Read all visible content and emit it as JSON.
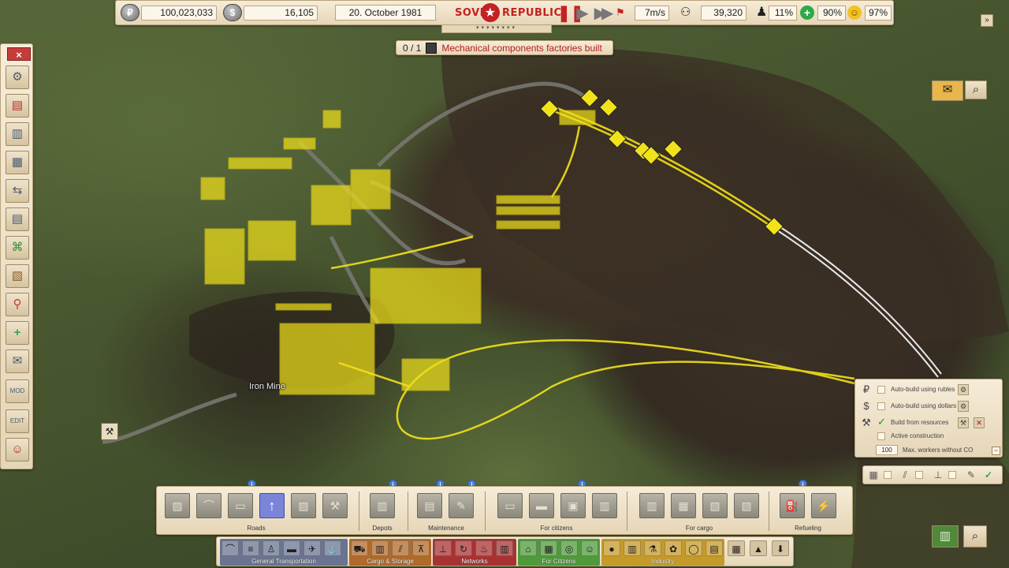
{
  "topbar": {
    "rubles_icon": "₽",
    "rubles": "100,023,033",
    "dollars_icon": "$",
    "dollars": "16,105",
    "date": "20. October 1981",
    "logo_left": "SOVIE",
    "logo_right": "REPUBLIC",
    "pause_icon": "pause-icon",
    "play_icon": "play-icon",
    "fast_icon": "fast-forward-icon",
    "wind_speed": "7m/s",
    "population": "39,320",
    "unemployment": "11%",
    "health": "90%",
    "happiness": "97%",
    "colors": {
      "pause": "#c32222",
      "health": "#2fa84a",
      "happiness": "#f2c221"
    }
  },
  "objective": {
    "count": "0 / 1",
    "text": "Mechanical components factories built"
  },
  "map": {
    "labels": {
      "iron_mine": "Iron Mine"
    },
    "colors": {
      "construction": "#f2e21a",
      "rail": "#e8e8e8",
      "road": "#7a7a74"
    }
  },
  "left_toolbar": {
    "close": "×",
    "buttons": [
      {
        "name": "settings",
        "glyph": "⚙"
      },
      {
        "name": "red-book",
        "glyph": "▤"
      },
      {
        "name": "buildings",
        "glyph": "▥"
      },
      {
        "name": "statistics",
        "glyph": "▦"
      },
      {
        "name": "transport",
        "glyph": "⇆"
      },
      {
        "name": "documents",
        "glyph": "▤"
      },
      {
        "name": "network-map",
        "glyph": "⌘"
      },
      {
        "name": "overview",
        "glyph": "▧"
      },
      {
        "name": "location-pin",
        "glyph": "⚲"
      },
      {
        "name": "add-building",
        "glyph": "+"
      },
      {
        "name": "mail",
        "glyph": "✉"
      },
      {
        "name": "mod",
        "glyph": "MOD"
      },
      {
        "name": "edit",
        "glyph": "EDIT"
      },
      {
        "name": "portrait",
        "glyph": "☺"
      }
    ]
  },
  "build_panel": {
    "auto_rubles": "Auto-build using rubles",
    "auto_dollars": "Auto-build using dollars",
    "from_resources": "Build from resources",
    "active_construction": "Active construction",
    "max_workers_value": "100",
    "max_workers_label": "Max. workers without CO",
    "check_mark": "✓"
  },
  "category_panel": {
    "labels": {
      "roads": "Roads",
      "depots": "Depots",
      "maintenance": "Maintenance",
      "citizens": "For citizens",
      "cargo": "For cargo",
      "refueling": "Refueling"
    },
    "active_glyph": "↑",
    "info_glyph": "i"
  },
  "tab_bar": {
    "general": "General Transportation",
    "cargo": "Cargo & Storage",
    "networks": "Networks",
    "citizens": "For Citizens",
    "industry": "Industry",
    "colors": {
      "general": "#6a7490",
      "cargo": "#b06a2a",
      "networks": "#a83232",
      "citizens": "#4f9a3a",
      "industry": "#c49a28"
    }
  }
}
